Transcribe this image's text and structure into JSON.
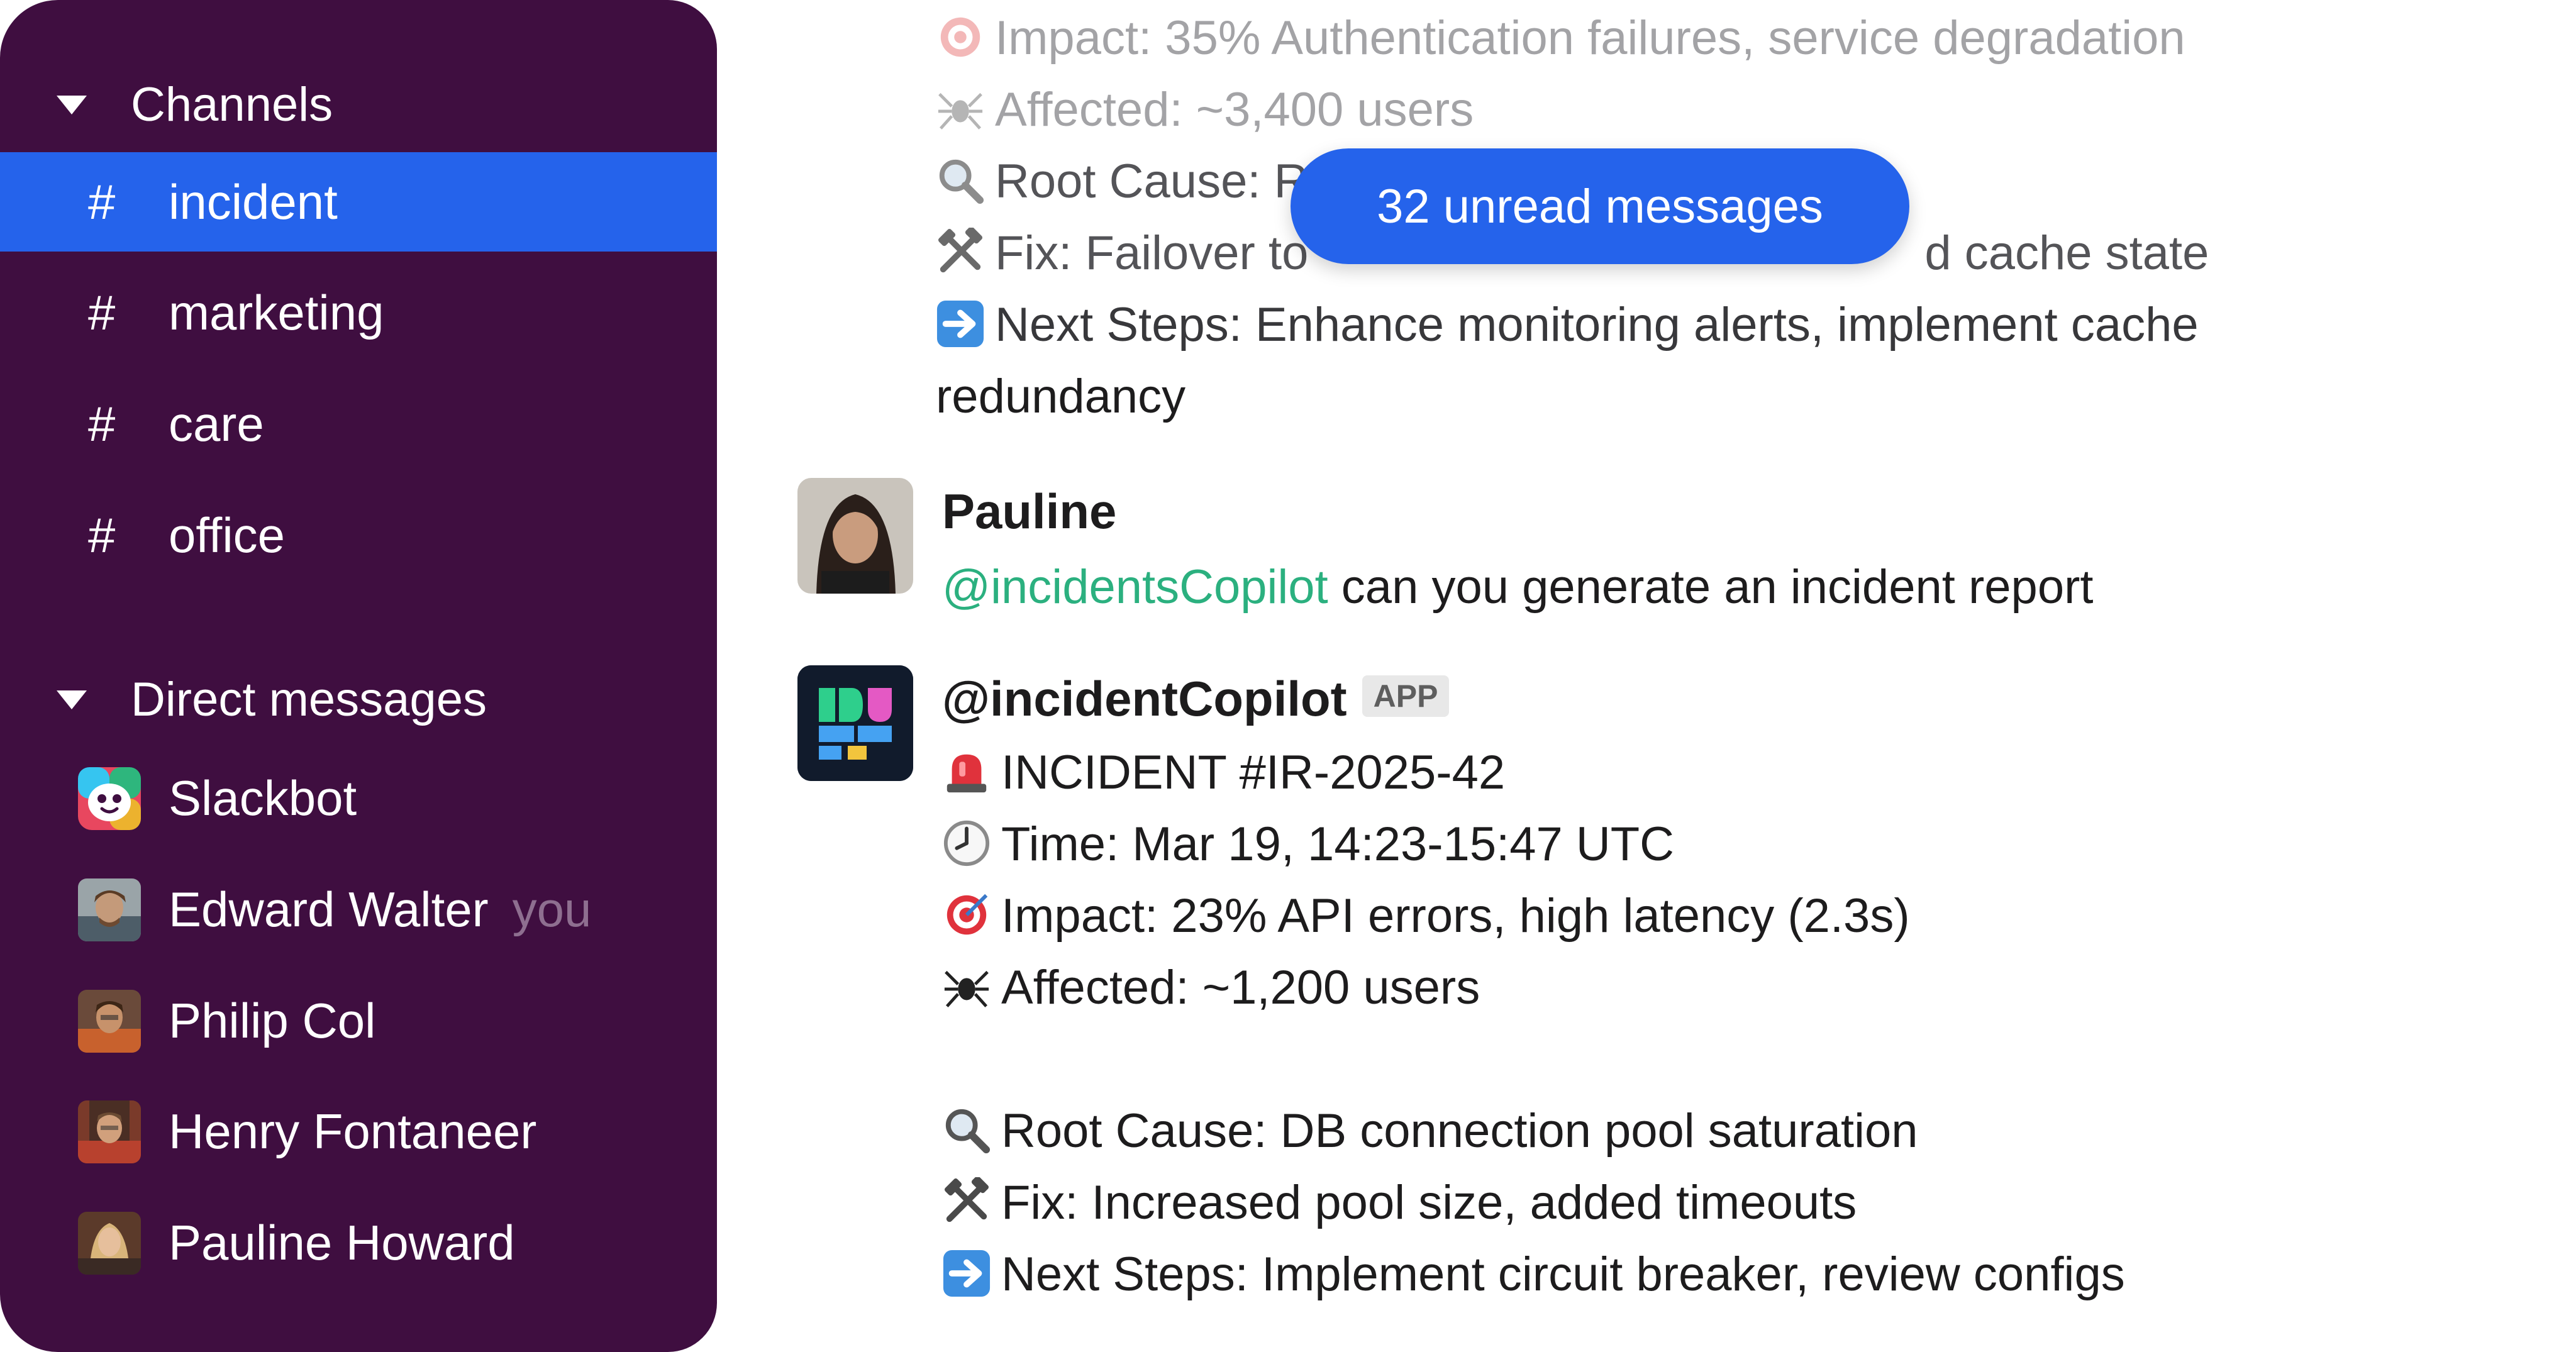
{
  "sidebar": {
    "channels_header": "Channels",
    "channels": [
      {
        "label": "incident",
        "active": true
      },
      {
        "label": "marketing",
        "active": false
      },
      {
        "label": "care",
        "active": false
      },
      {
        "label": "office",
        "active": false
      }
    ],
    "channel_prefix": "#",
    "dm_header": "Direct messages",
    "direct_messages": [
      {
        "label": "Slackbot"
      },
      {
        "label": "Edward Walter",
        "suffix": "you"
      },
      {
        "label": "Philip Col"
      },
      {
        "label": "Henry Fontaneer"
      },
      {
        "label": "Pauline Howard"
      }
    ]
  },
  "unread_pill": "32 unread messages",
  "previous_report": {
    "impact": "Impact: 35% Authentication failures, service degradation",
    "affected": "Affected: ~3,400 users",
    "root_cause": "Root Cause: R",
    "fix_start": "Fix: Failover to",
    "fix_end": "d cache state",
    "next_steps_1": "Next Steps: Enhance monitoring alerts, implement cache",
    "next_steps_2": "redundancy"
  },
  "message_pauline": {
    "author": "Pauline",
    "mention": "@incidentsCopilot",
    "text": " can you generate an incident report"
  },
  "message_bot": {
    "author": "@incidentCopilot",
    "badge": "APP",
    "title": "INCIDENT #IR-2025-42",
    "time": "Time: Mar 19, 14:23-15:47 UTC",
    "impact": "Impact: 23% API errors, high latency (2.3s)",
    "affected": "Affected: ~1,200 users",
    "root_cause": "Root Cause: DB connection pool saturation",
    "fix": "Fix: Increased pool size, added timeouts",
    "next_steps": "Next Steps: Implement circuit breaker, review configs"
  },
  "colors": {
    "sidebar_bg": "#3f0e40",
    "active_item": "#2563eb",
    "mention": "#2bb07f",
    "pill": "#2563eb"
  }
}
